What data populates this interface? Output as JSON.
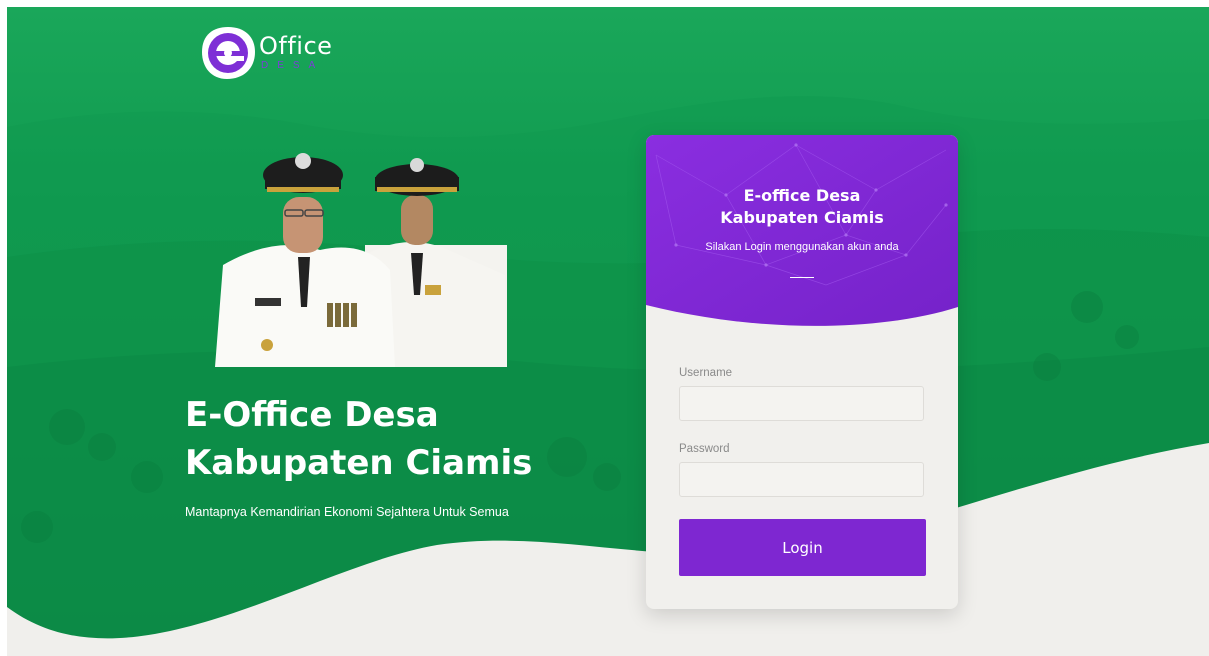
{
  "logo": {
    "word": "Office",
    "sub": "DESA"
  },
  "hero": {
    "title_line1": "E-Office Desa",
    "title_line2": "Kabupaten Ciamis",
    "tagline": "Mantapnya Kemandirian Ekonomi Sejahtera Untuk Semua"
  },
  "card": {
    "title_line1": "E-office Desa",
    "title_line2": "Kabupaten Ciamis",
    "subtitle": "Silakan Login menggunakan akun anda",
    "username_label": "Username",
    "username_value": "",
    "password_label": "Password",
    "password_value": "",
    "login_label": "Login"
  },
  "colors": {
    "hero_green": "#12944d",
    "brand_purple": "#7e27d1",
    "card_bg": "#f1f0ed",
    "wave_bg": "#f0efec"
  },
  "icons": {
    "logo_badge": "e-logo-icon"
  }
}
